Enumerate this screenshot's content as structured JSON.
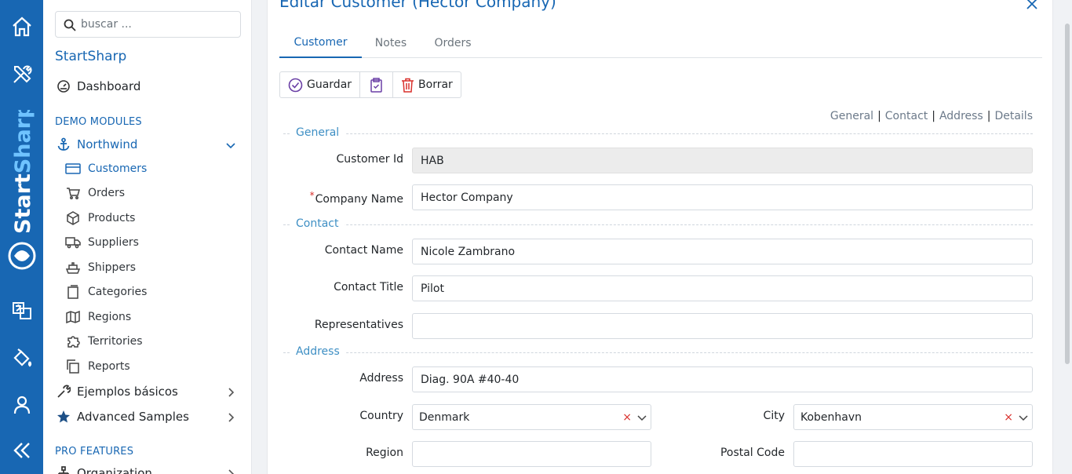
{
  "rail": {
    "brand_text": "StartSharp"
  },
  "sidebar": {
    "search_placeholder": "buscar ...",
    "brand": "StartSharp",
    "dashboard": "Dashboard",
    "demo_heading": "DEMO MODULES",
    "northwind": "Northwind",
    "items": [
      {
        "label": "Customers",
        "icon": "card-icon"
      },
      {
        "label": "Orders",
        "icon": "cart-icon"
      },
      {
        "label": "Products",
        "icon": "box-icon"
      },
      {
        "label": "Suppliers",
        "icon": "truck-icon"
      },
      {
        "label": "Shippers",
        "icon": "ship-icon"
      },
      {
        "label": "Categories",
        "icon": "folder-icon"
      },
      {
        "label": "Regions",
        "icon": "map-icon"
      },
      {
        "label": "Territories",
        "icon": "puzzle-icon"
      },
      {
        "label": "Reports",
        "icon": "copy-icon"
      }
    ],
    "basic_samples": "Ejemplos básicos",
    "advanced_samples": "Advanced Samples",
    "pro_heading": "PRO FEATURES",
    "organization": "Organization"
  },
  "dialog": {
    "title": "Editar Customer (Hector Company)",
    "tabs": [
      "Customer",
      "Notes",
      "Orders"
    ],
    "toolbar": {
      "save": "Guardar",
      "delete": "Borrar"
    },
    "category_links": [
      "General",
      "Contact",
      "Address",
      "Details"
    ],
    "sections": {
      "general": "General",
      "contact": "Contact",
      "address": "Address"
    },
    "fields": {
      "customer_id": {
        "label": "Customer Id",
        "value": "HAB"
      },
      "company_name": {
        "label": "Company Name",
        "value": "Hector Company",
        "required_mark": "*"
      },
      "contact_name": {
        "label": "Contact Name",
        "value": "Nicole Zambrano"
      },
      "contact_title": {
        "label": "Contact Title",
        "value": "Pilot"
      },
      "representatives": {
        "label": "Representatives",
        "value": ""
      },
      "address": {
        "label": "Address",
        "value": "Diag. 90A #40-40"
      },
      "country": {
        "label": "Country",
        "value": "Denmark"
      },
      "city": {
        "label": "City",
        "value": "Kobenhavn"
      },
      "region": {
        "label": "Region",
        "value": ""
      },
      "postal_code": {
        "label": "Postal Code",
        "value": ""
      }
    },
    "clear_glyph": "×"
  },
  "colors": {
    "accent": "#1867b3",
    "rail": "#1867b3",
    "section": "#3e8fc4",
    "danger": "#d9302c"
  }
}
